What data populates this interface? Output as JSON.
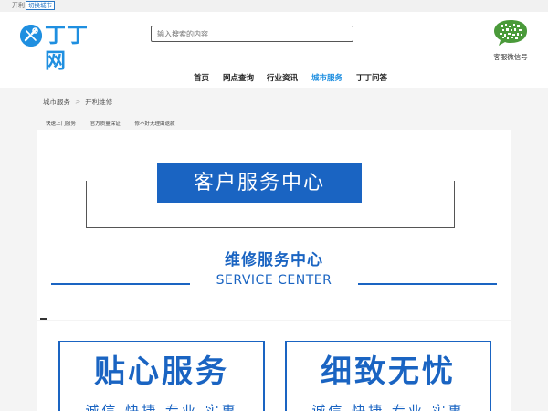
{
  "topbar": {
    "city": "开利",
    "switch_label": "切换城市"
  },
  "header": {
    "logo_text": "丁丁网",
    "search_placeholder": "输入搜索的内容",
    "qr_label": "客服微信号"
  },
  "nav": {
    "items": [
      {
        "label": "首页"
      },
      {
        "label": "网点查询"
      },
      {
        "label": "行业资讯"
      },
      {
        "label": "城市服务",
        "active": true
      },
      {
        "label": "丁丁问答"
      }
    ]
  },
  "breadcrumb": {
    "items": [
      "城市服务",
      "开利维修"
    ],
    "separator": ">"
  },
  "tags": [
    "快速上门服务",
    "官方质量保证",
    "修不好无理由退款"
  ],
  "banner": {
    "headline": "客户服务中心",
    "title": "维修服务中心",
    "subtitle": "SERVICE CENTER"
  },
  "features": [
    {
      "title": "贴心服务",
      "subtitle": "诚信 快捷 专业 实惠"
    },
    {
      "title": "细致无忧",
      "subtitle": "诚信 快捷 专业 实惠"
    }
  ],
  "colors": {
    "brand": "#1f8fe0",
    "banner_blue": "#1a64c2",
    "active_nav": "#1f8fe0"
  }
}
